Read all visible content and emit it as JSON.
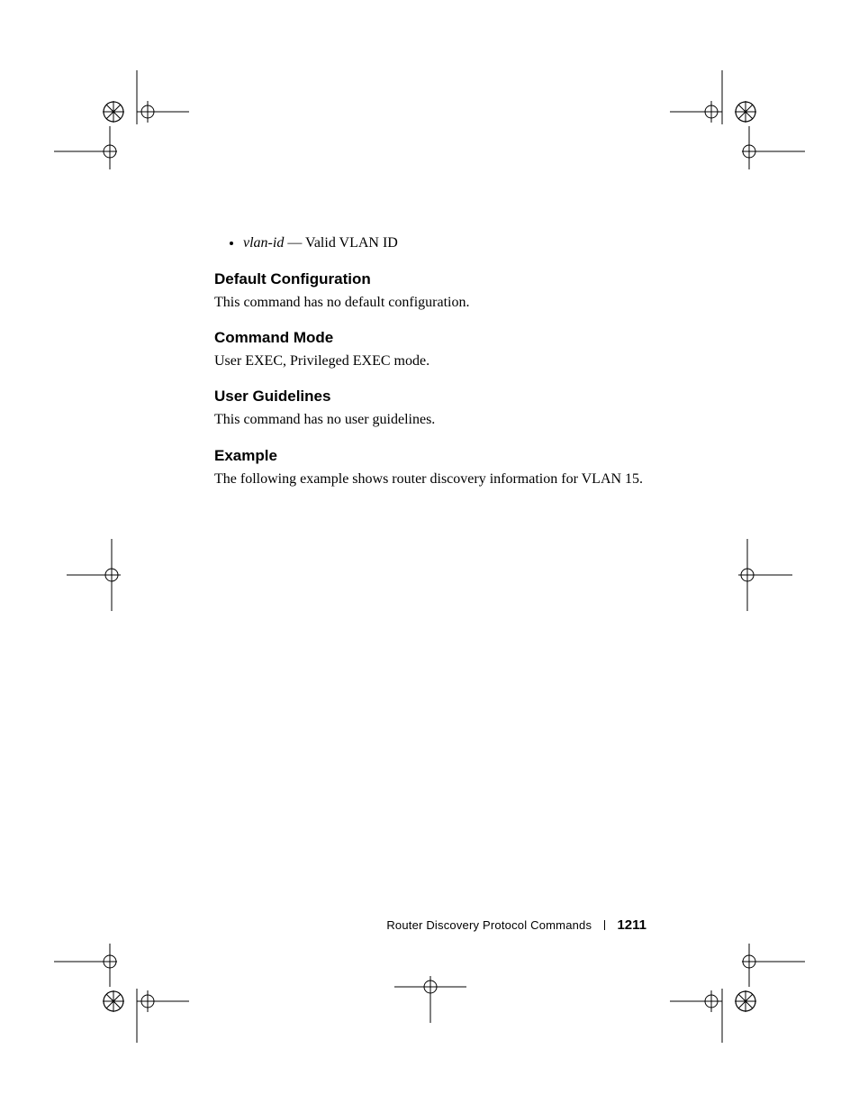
{
  "bullet": {
    "term": "vlan-id",
    "sep": " — ",
    "desc": "Valid VLAN ID"
  },
  "sections": {
    "default_cfg": {
      "heading": "Default Configuration",
      "body": "This command has no default configuration."
    },
    "cmd_mode": {
      "heading": "Command Mode",
      "body": "User EXEC, Privileged EXEC mode."
    },
    "guidelines": {
      "heading": "User Guidelines",
      "body": "This command has no user guidelines."
    },
    "example": {
      "heading": "Example",
      "body": "The following example shows router discovery information for VLAN 15."
    }
  },
  "footer": {
    "title": "Router Discovery Protocol Commands",
    "page": "1211"
  }
}
